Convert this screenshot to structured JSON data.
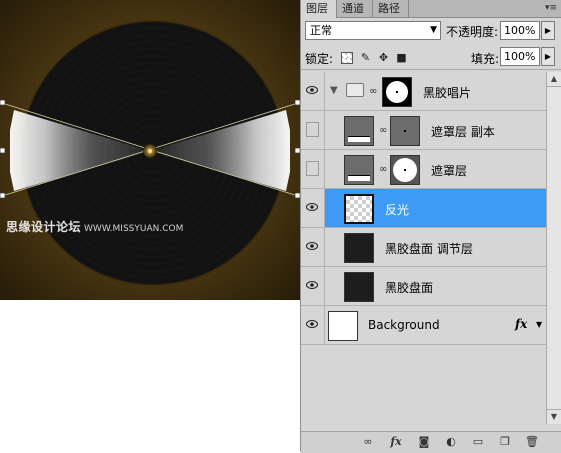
{
  "panel": {
    "tabs": [
      {
        "label": "图层",
        "active": true
      },
      {
        "label": "通道",
        "active": false
      },
      {
        "label": "路径",
        "active": false
      }
    ],
    "menu_icon": "panel-menu-icon"
  },
  "blend": {
    "mode": "正常",
    "opacity_label": "不透明度:",
    "opacity_value": "100%"
  },
  "lock": {
    "label": "锁定:",
    "fill_label": "填充:",
    "fill_value": "100%",
    "icons": [
      "lock-transparent-icon",
      "lock-paint-icon",
      "lock-move-icon",
      "lock-all-icon"
    ]
  },
  "layers": [
    {
      "name": "黑胶唱片",
      "type": "group",
      "visible": true,
      "mask": true
    },
    {
      "name": "遮罩层 副本",
      "type": "adjustment",
      "visible": false,
      "mask": true
    },
    {
      "name": "遮罩层",
      "type": "adjustment",
      "visible": false,
      "mask": true
    },
    {
      "name": "反光",
      "type": "normal",
      "visible": true,
      "selected": true
    },
    {
      "name": "黑胶盘面 调节层",
      "type": "normal",
      "visible": true
    },
    {
      "name": "黑胶盘面",
      "type": "normal",
      "visible": true
    },
    {
      "name": "Background",
      "type": "background",
      "visible": true,
      "fx": "fx"
    }
  ],
  "canvas": {
    "watermark_cn": "思缘设计论坛",
    "watermark_url": "WWW.MISSYUAN.COM"
  },
  "bottom_icons": [
    "link-layers-icon",
    "fx-icon",
    "add-mask-icon",
    "adjustment-layer-icon",
    "new-group-icon",
    "new-layer-icon",
    "trash-icon"
  ],
  "colors": {
    "selection": "#3d9bf5",
    "panel_bg": "#d6d6d6"
  }
}
